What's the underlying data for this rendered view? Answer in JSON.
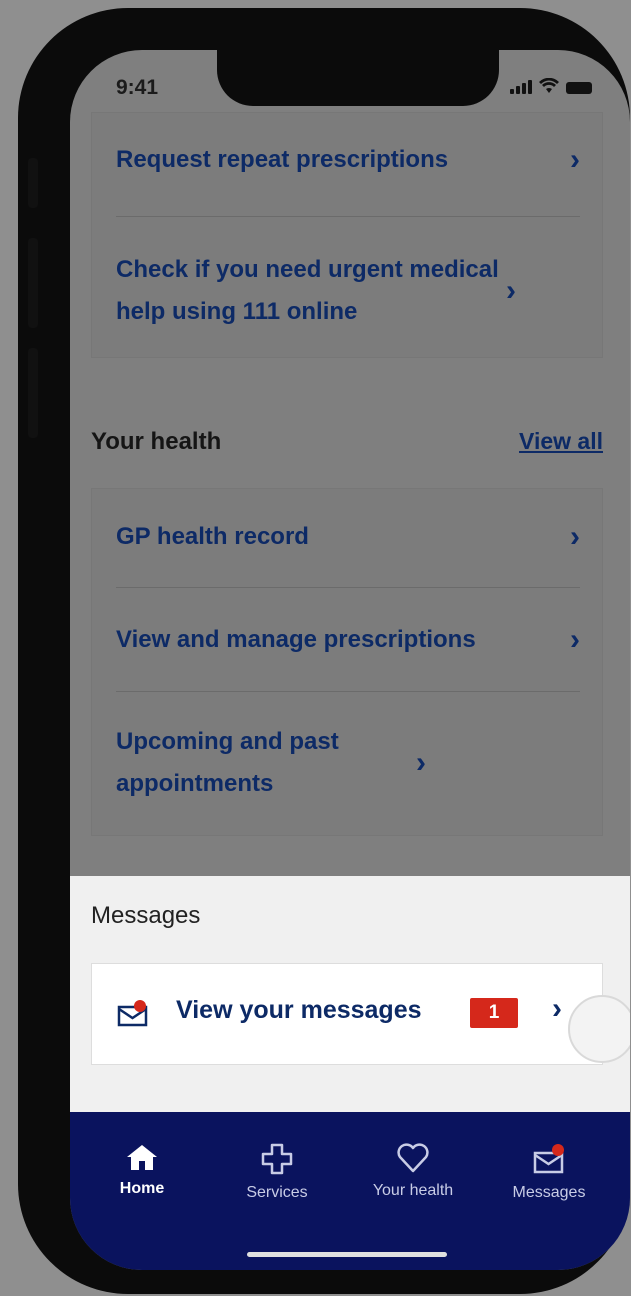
{
  "status_bar": {
    "time": "9:41"
  },
  "top_card": {
    "items": [
      {
        "label": "Request repeat prescriptions"
      },
      {
        "label": "Check if you need urgent medical help using 111 online"
      }
    ]
  },
  "your_health": {
    "title": "Your health",
    "view_all": "View all",
    "items": [
      {
        "label": "GP health record"
      },
      {
        "label": "View and manage prescriptions"
      },
      {
        "label": "Upcoming and past appointments"
      }
    ]
  },
  "messages": {
    "title": "Messages",
    "item": {
      "label": "View your messages",
      "badge": "1",
      "icon": "envelope-notification-icon"
    }
  },
  "tab_bar": {
    "items": [
      {
        "label": "Home",
        "icon": "home-icon",
        "active": true
      },
      {
        "label": "Services",
        "icon": "cross-icon",
        "active": false
      },
      {
        "label": "Your health",
        "icon": "heart-icon",
        "active": false
      },
      {
        "label": "Messages",
        "icon": "envelope-icon",
        "active": false
      }
    ]
  },
  "colors": {
    "nhs_blue_dark": "#0a135e",
    "link_blue": "#0d2a66",
    "badge_red": "#d5281b"
  }
}
